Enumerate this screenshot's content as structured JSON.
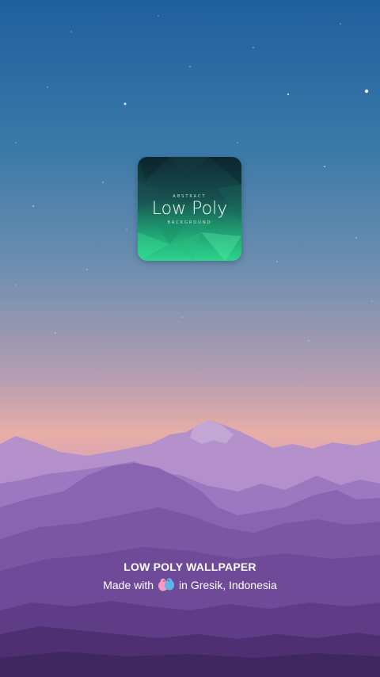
{
  "icon": {
    "top_text": "ABSTRACT",
    "main_text": "Low Poly",
    "bottom_text": "BACKGROUND"
  },
  "footer": {
    "app_name": "LOW POLY WALLPAPER",
    "made_with": "Made with",
    "location": "in Gresik, Indonesia"
  },
  "colors": {
    "icon_top": "#0f2b33",
    "icon_bottom": "#2fd48d",
    "text": "#ffffff"
  }
}
